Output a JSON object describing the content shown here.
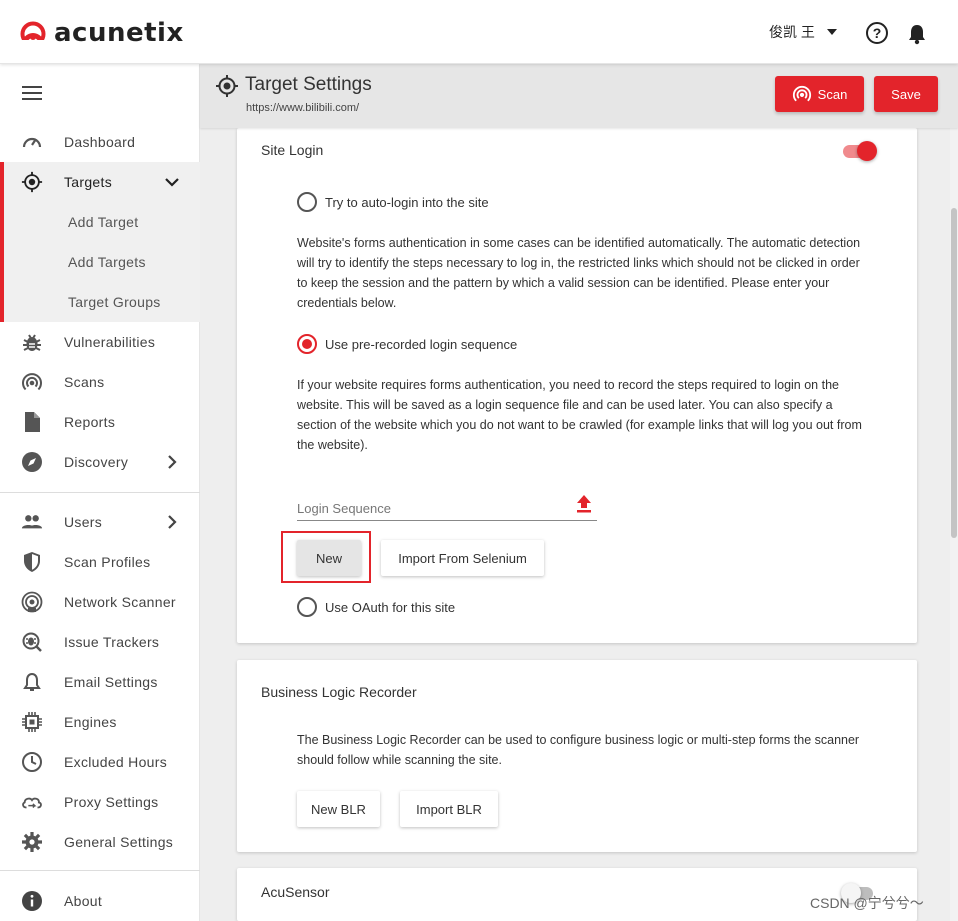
{
  "brand": {
    "name": "acunetix",
    "color": "#e3242b"
  },
  "header": {
    "user_name": "俊凯 王",
    "help_icon": "help-circle-icon",
    "bell_icon": "bell-icon"
  },
  "sidebar": {
    "items": [
      {
        "label": "Dashboard",
        "icon": "speedometer-icon"
      },
      {
        "label": "Targets",
        "icon": "crosshair-icon"
      },
      {
        "label": "Add Target"
      },
      {
        "label": "Add Targets"
      },
      {
        "label": "Target Groups"
      },
      {
        "label": "Vulnerabilities",
        "icon": "bug-icon"
      },
      {
        "label": "Scans",
        "icon": "radar-icon"
      },
      {
        "label": "Reports",
        "icon": "document-icon"
      },
      {
        "label": "Discovery",
        "icon": "compass-icon"
      },
      {
        "label": "Users",
        "icon": "users-icon"
      },
      {
        "label": "Scan Profiles",
        "icon": "shield-icon"
      },
      {
        "label": "Network Scanner",
        "icon": "network-scanner-icon"
      },
      {
        "label": "Issue Trackers",
        "icon": "issue-tracker-icon"
      },
      {
        "label": "Email Settings",
        "icon": "bell-outline-icon"
      },
      {
        "label": "Engines",
        "icon": "chip-icon"
      },
      {
        "label": "Excluded Hours",
        "icon": "clock-icon"
      },
      {
        "label": "Proxy Settings",
        "icon": "cloud-sync-icon"
      },
      {
        "label": "General Settings",
        "icon": "gear-icon"
      },
      {
        "label": "About",
        "icon": "info-icon"
      }
    ]
  },
  "page": {
    "title": "Target Settings",
    "url": "https://www.bilibili.com/",
    "scan_label": "Scan",
    "save_label": "Save"
  },
  "site_login": {
    "title": "Site Login",
    "enabled": true,
    "auto_login_label": "Try to auto-login into the site",
    "auto_login_desc": "Website's forms authentication in some cases can be identified automatically. The automatic detection will try to identify the steps necessary to log in, the restricted links which should not be clicked in order to keep the session and the pattern by which a valid session can be identified. Please enter your credentials below.",
    "prerecorded_label": "Use pre-recorded login sequence",
    "prerecorded_desc": "If your website requires forms authentication, you need to record the steps required to login on the website. This will be saved as a login sequence file and can be used later. You can also specify a section of the website which you do not want to be crawled (for example links that will log you out from the website).",
    "login_sequence_placeholder": "Login Sequence",
    "new_label": "New",
    "import_selenium_label": "Import From Selenium",
    "oauth_label": "Use OAuth for this site",
    "selected_option": "prerecorded"
  },
  "blr": {
    "title": "Business Logic Recorder",
    "desc": "The Business Logic Recorder can be used to configure business logic or multi-step forms the scanner should follow while scanning the site.",
    "new_label": "New BLR",
    "import_label": "Import BLR"
  },
  "acusensor": {
    "title": "AcuSensor",
    "enabled": false
  },
  "watermark": "CSDN @宁兮兮～"
}
